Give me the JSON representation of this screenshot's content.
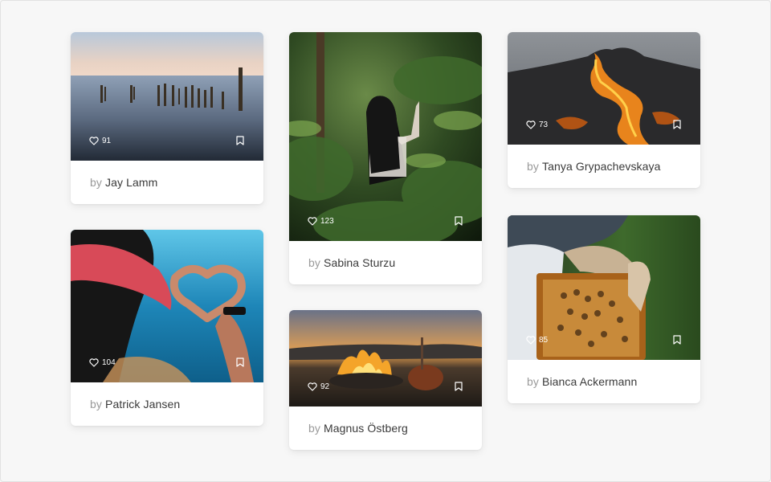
{
  "by_prefix": "by",
  "cards": [
    {
      "photo": "seascape-with-wooden-posts",
      "likes": "91",
      "author": "Jay Lamm"
    },
    {
      "photo": "person-in-tropical-plants",
      "likes": "123",
      "author": "Sabina Sturzu"
    },
    {
      "photo": "lava-flow-volcano",
      "likes": "73",
      "author": "Tanya Grypachevskaya"
    },
    {
      "photo": "underwater-heart-hands",
      "likes": "104",
      "author": "Patrick Jansen"
    },
    {
      "photo": "campfire-at-sunset",
      "likes": "92",
      "author": "Magnus Östberg"
    },
    {
      "photo": "beekeeper-holding-frame",
      "likes": "85",
      "author": "Bianca Ackermann"
    }
  ],
  "icons": {
    "like": "heart-icon",
    "save": "bookmark-icon"
  }
}
